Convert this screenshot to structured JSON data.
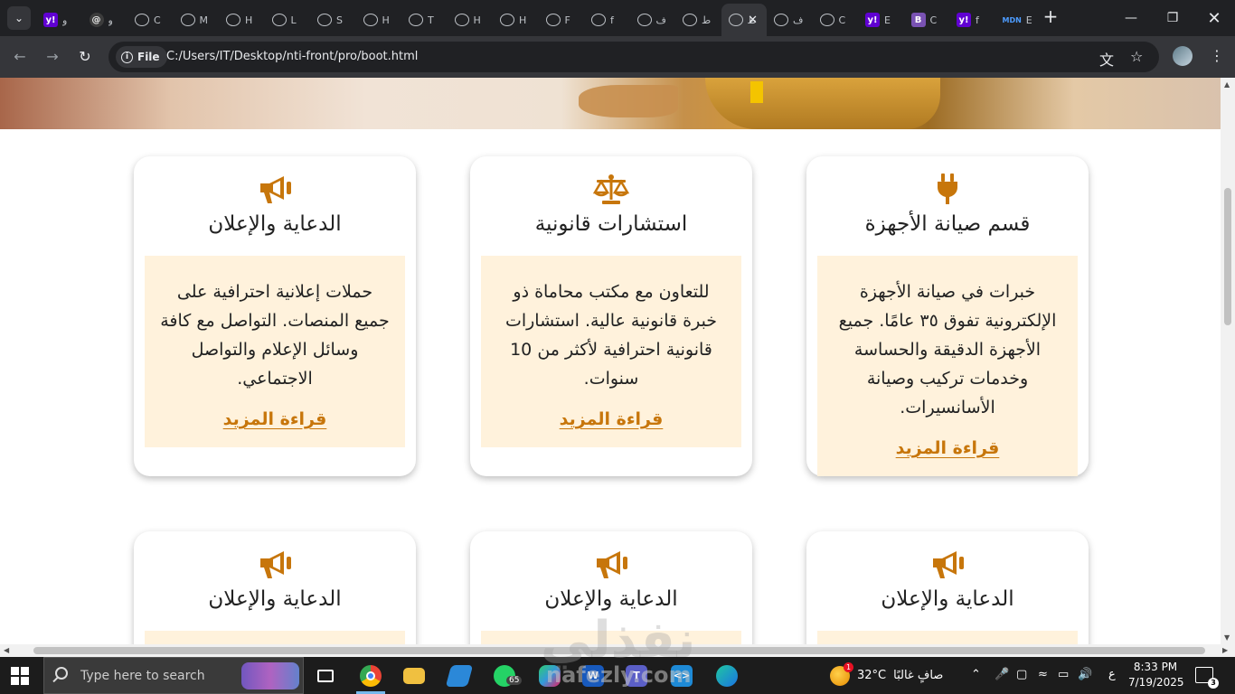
{
  "browser": {
    "tabs": [
      {
        "icon": "yahoo-icon",
        "fav": "y!",
        "label": "و",
        "type": "y"
      },
      {
        "icon": "threads-icon",
        "fav": "@",
        "label": "و",
        "type": "dark"
      },
      {
        "icon": "globe-icon",
        "fav": "",
        "label": "C",
        "type": "globe"
      },
      {
        "icon": "globe-icon",
        "fav": "",
        "label": "M",
        "type": "globe"
      },
      {
        "icon": "globe-icon",
        "fav": "",
        "label": "H",
        "type": "globe"
      },
      {
        "icon": "globe-icon",
        "fav": "",
        "label": "L",
        "type": "globe"
      },
      {
        "icon": "globe-icon",
        "fav": "",
        "label": "S",
        "type": "globe"
      },
      {
        "icon": "globe-icon",
        "fav": "",
        "label": "H",
        "type": "globe"
      },
      {
        "icon": "globe-icon",
        "fav": "",
        "label": "T",
        "type": "globe"
      },
      {
        "icon": "globe-icon",
        "fav": "",
        "label": "H",
        "type": "globe"
      },
      {
        "icon": "globe-icon",
        "fav": "",
        "label": "H",
        "type": "globe"
      },
      {
        "icon": "globe-icon",
        "fav": "",
        "label": "F",
        "type": "globe"
      },
      {
        "icon": "globe-icon",
        "fav": "",
        "label": "f",
        "type": "globe"
      },
      {
        "icon": "globe-icon",
        "fav": "",
        "label": "ف",
        "type": "globe"
      },
      {
        "icon": "globe-icon",
        "fav": "",
        "label": "ط",
        "type": "globe"
      },
      {
        "icon": "globe-icon",
        "fav": "",
        "label": "ط",
        "type": "active"
      },
      {
        "icon": "globe-icon",
        "fav": "",
        "label": "ف",
        "type": "globe"
      },
      {
        "icon": "globe-icon",
        "fav": "",
        "label": "C",
        "type": "globe"
      },
      {
        "icon": "yahoo-icon",
        "fav": "y!",
        "label": "E",
        "type": "y"
      },
      {
        "icon": "bootstrap-icon",
        "fav": "B",
        "label": "C",
        "type": "b"
      },
      {
        "icon": "yahoo-icon",
        "fav": "y!",
        "label": "f",
        "type": "y"
      },
      {
        "icon": "mdn-icon",
        "fav": "MDN",
        "label": "E",
        "type": "mdn"
      }
    ],
    "address": {
      "chip": "File",
      "url": "C:/Users/IT/Desktop/nti-front/pro/boot.html"
    }
  },
  "cards": [
    {
      "icon": "plug-icon",
      "title": "قسم صيانة الأجهزة",
      "body": "خبرات في صيانة الأجهزة الإلكترونية تفوق ٣٥ عامًا. جميع الأجهزة الدقيقة والحساسة وخدمات تركيب وصيانة الأسانسيرات.",
      "more": "قراءة المزيد"
    },
    {
      "icon": "scale-icon",
      "title": "استشارات قانونية",
      "body": "للتعاون مع مكتب محاماة ذو خبرة قانونية عالية. استشارات قانونية احترافية لأكثر من 10 سنوات.",
      "more": "قراءة المزيد"
    },
    {
      "icon": "megaphone-icon",
      "title": "الدعاية والإعلان",
      "body": "حملات إعلانية احترافية على جميع المنصات. التواصل مع كافة وسائل الإعلام والتواصل الاجتماعي.",
      "more": "قراءة المزيد"
    },
    {
      "icon": "megaphone-icon",
      "title": "الدعاية والإعلان",
      "body": "",
      "more": ""
    },
    {
      "icon": "megaphone-icon",
      "title": "الدعاية والإعلان",
      "body": "",
      "more": ""
    },
    {
      "icon": "megaphone-icon",
      "title": "الدعاية والإعلان",
      "body": "",
      "more": ""
    }
  ],
  "colors": {
    "accent": "#c7760b",
    "card_body": "#fff2dc"
  },
  "watermark": {
    "arabic": "نفذلي",
    "latin": "nafezly.com"
  },
  "taskbar": {
    "search_placeholder": "Type here to search",
    "whatsapp_badge": "65",
    "weather_temp": "32°C",
    "weather_text": "صافٍ غالبًا",
    "weather_badge": "1",
    "lang": "ع",
    "time": "8:33 PM",
    "date": "7/19/2025",
    "notif_count": "3"
  }
}
